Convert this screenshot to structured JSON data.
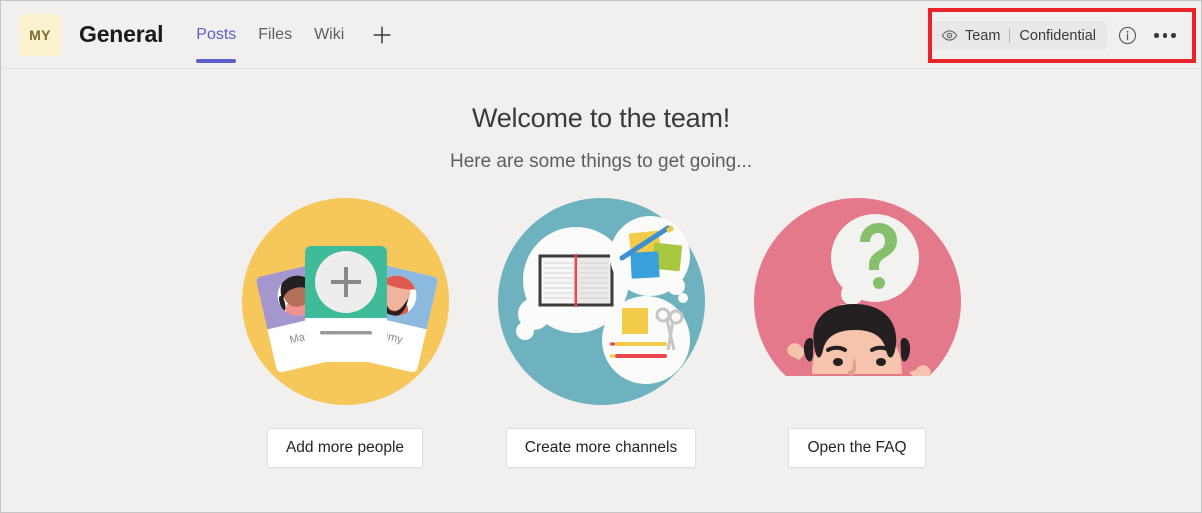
{
  "header": {
    "avatar_initials": "MY",
    "channel_title": "General",
    "tabs": [
      {
        "label": "Posts",
        "active": true
      },
      {
        "label": "Files",
        "active": false
      },
      {
        "label": "Wiki",
        "active": false
      }
    ],
    "add_tab_label": "+",
    "sensitivity": {
      "eye_icon": "eye-icon",
      "scope_label": "Team",
      "classification_label": "Confidential"
    },
    "info_icon": "info-circle-icon",
    "more_options_icon": "more-options-icon",
    "highlight_color": "#e8242a"
  },
  "main": {
    "title": "Welcome to the team!",
    "subtitle": "Here are some things to get going...",
    "cards": [
      {
        "illustration": "people-cards-illustration",
        "circle_color": "#f6c75a",
        "names": {
          "left": "Maxine",
          "right": "y"
        },
        "button_label": "Add more people"
      },
      {
        "illustration": "channels-thought-bubbles-illustration",
        "circle_color": "#6eb2bf",
        "button_label": "Create more channels"
      },
      {
        "illustration": "faq-question-illustration",
        "circle_color": "#e4798b",
        "button_label": "Open the FAQ"
      }
    ]
  },
  "theme": {
    "background": "#f1f0ef",
    "accent_purple": "#5b5fc7",
    "avatar_background": "#fbf3cf"
  }
}
